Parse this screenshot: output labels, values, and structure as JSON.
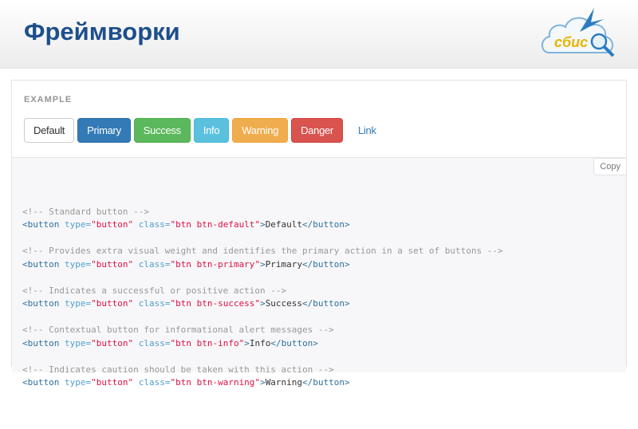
{
  "header": {
    "title": "Фреймворки",
    "logo_text": "сбис"
  },
  "example": {
    "label": "EXAMPLE",
    "buttons": [
      "Default",
      "Primary",
      "Success",
      "Info",
      "Warning",
      "Danger",
      "Link"
    ]
  },
  "code": {
    "copy_label": "Copy",
    "blocks": [
      {
        "comment": "<!-- Standard button -->",
        "cls": "btn btn-default",
        "text": "Default"
      },
      {
        "comment": "<!-- Provides extra visual weight and identifies the primary action in a set of buttons -->",
        "cls": "btn btn-primary",
        "text": "Primary"
      },
      {
        "comment": "<!-- Indicates a successful or positive action -->",
        "cls": "btn btn-success",
        "text": "Success"
      },
      {
        "comment": "<!-- Contextual button for informational alert messages -->",
        "cls": "btn btn-info",
        "text": "Info"
      },
      {
        "comment": "<!-- Indicates caution should be taken with this action -->",
        "cls": "btn btn-warning",
        "text": "Warning"
      }
    ],
    "tag_open": "<button",
    "attr_type": "type=",
    "val_type": "\"button\"",
    "attr_class": "class=",
    "tag_close": "</button>"
  }
}
